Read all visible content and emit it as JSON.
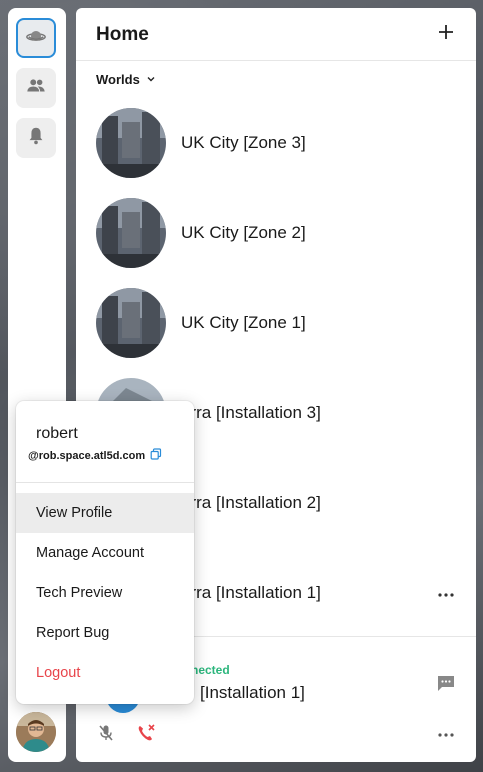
{
  "rail": {
    "items": [
      {
        "name": "worlds",
        "icon": "planet-icon",
        "active": true
      },
      {
        "name": "friends",
        "icon": "people-icon",
        "active": false
      },
      {
        "name": "notifications",
        "icon": "bell-icon",
        "active": false
      }
    ]
  },
  "panel": {
    "title": "Home",
    "add_icon": "plus-icon",
    "section_label": "Worlds",
    "worlds": [
      {
        "name": "UK City [Zone 3]"
      },
      {
        "name": "UK City [Zone 2]"
      },
      {
        "name": "UK City [Zone 1]"
      },
      {
        "name": "erra [Installation 3]"
      },
      {
        "name": "erra [Installation 2]"
      },
      {
        "name": "erra [Installation 1]"
      }
    ],
    "connection": {
      "status": "nected",
      "world": "[Installation 1]"
    }
  },
  "menu": {
    "username": "robert",
    "handle": "@rob.space.atl5d.com",
    "items": [
      {
        "label": "View Profile"
      },
      {
        "label": "Manage Account"
      },
      {
        "label": "Tech Preview"
      },
      {
        "label": "Report Bug"
      },
      {
        "label": "Logout"
      }
    ]
  },
  "colors": {
    "accent": "#2a8cd8",
    "connected": "#2cb67d",
    "danger": "#e8444a"
  }
}
